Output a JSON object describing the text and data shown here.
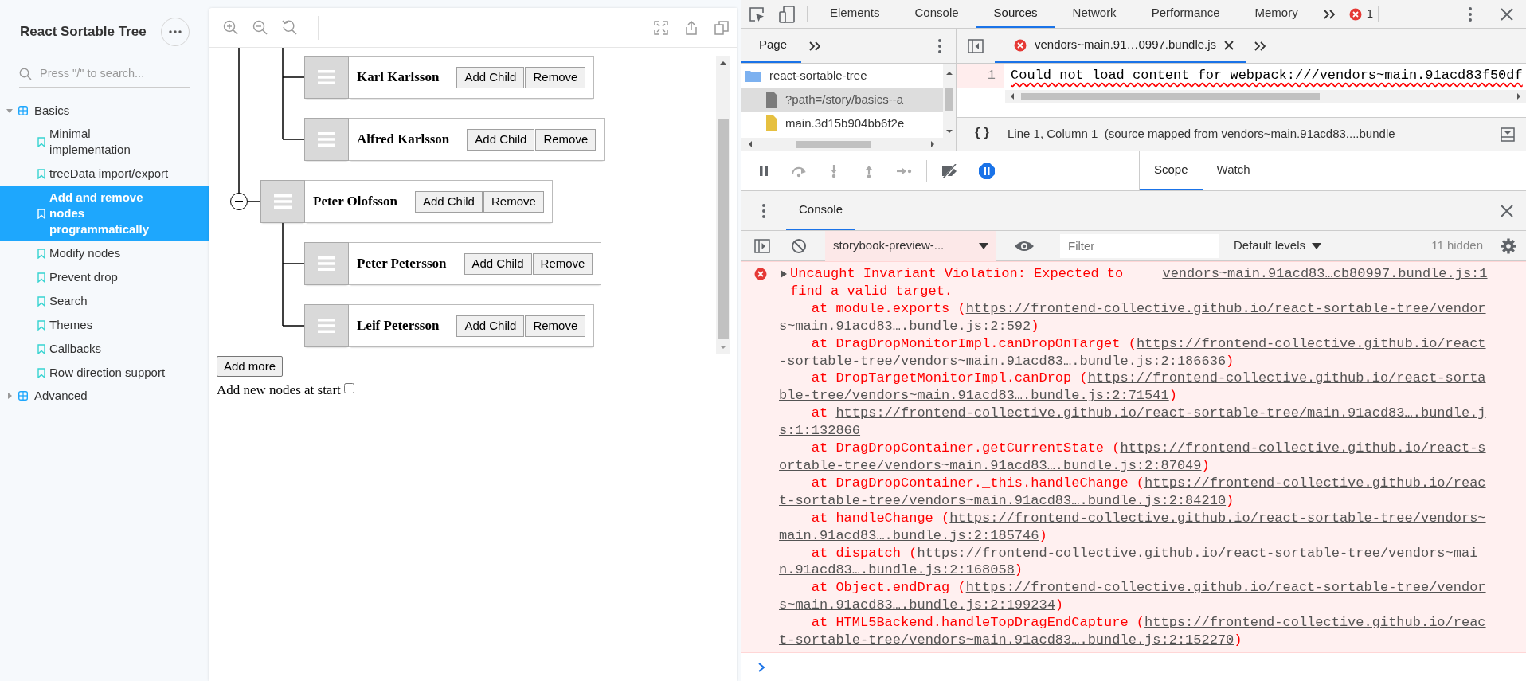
{
  "sidebar": {
    "title": "React Sortable Tree",
    "search": {
      "placeholder": "Press \"/\" to search..."
    },
    "groups": [
      {
        "label": "Basics",
        "expanded": true,
        "children": [
          {
            "label": "Minimal implementation",
            "selected": false
          },
          {
            "label": "treeData import/export",
            "selected": false
          },
          {
            "label": "Add and remove nodes programmatically",
            "selected": true
          },
          {
            "label": "Modify nodes",
            "selected": false
          },
          {
            "label": "Prevent drop",
            "selected": false
          },
          {
            "label": "Search",
            "selected": false
          },
          {
            "label": "Themes",
            "selected": false
          },
          {
            "label": "Callbacks",
            "selected": false
          },
          {
            "label": "Row direction support",
            "selected": false
          }
        ]
      },
      {
        "label": "Advanced",
        "expanded": false
      }
    ]
  },
  "preview": {
    "tree": {
      "nodes": [
        {
          "children": [
            {
              "title": "Karl Karlsson",
              "buttons": [
                "Add Child",
                "Remove"
              ]
            },
            {
              "title": "Alfred Karlsson",
              "buttons": [
                "Add Child",
                "Remove"
              ]
            }
          ]
        },
        {
          "title": "Peter Olofsson",
          "buttons": [
            "Add Child",
            "Remove"
          ],
          "expanded": true,
          "children": [
            {
              "title": "Peter Petersson",
              "buttons": [
                "Add Child",
                "Remove"
              ]
            },
            {
              "title": "Leif Petersson",
              "buttons": [
                "Add Child",
                "Remove"
              ]
            }
          ]
        }
      ]
    },
    "add_button": "Add more",
    "start_option": {
      "label": "Add new nodes at start",
      "checked": false
    }
  },
  "devtools": {
    "tabs": [
      {
        "label": "Elements",
        "selected": false
      },
      {
        "label": "Console",
        "selected": false
      },
      {
        "label": "Sources",
        "selected": true
      },
      {
        "label": "Network",
        "selected": false
      },
      {
        "label": "Performance",
        "selected": false
      },
      {
        "label": "Memory",
        "selected": false
      }
    ],
    "error_count": "1",
    "navigator": {
      "tabs": [
        {
          "label": "Page",
          "selected": true
        }
      ],
      "files": [
        {
          "kind": "folder",
          "name": "react-sortable-tree",
          "selected": false
        },
        {
          "kind": "document",
          "name": "?path=/story/basics--a",
          "selected": true
        },
        {
          "kind": "script",
          "name": "main.3d15b904bb6f2e",
          "selected": false
        }
      ]
    },
    "editor": {
      "tabs": [
        {
          "label": "vendors~main.91…0997.bundle.js",
          "selected": true,
          "error": true
        }
      ],
      "lines": [
        {
          "number": "1",
          "text": "Could not load content for webpack:///vendors~main.91acd83f50df"
        }
      ],
      "status": {
        "format": "{}",
        "position": "Line 1, Column 1",
        "source_prefix": "(source mapped from",
        "source_link": "vendors~main.91acd83....bundle"
      }
    },
    "sidebar_tabs": [
      {
        "label": "Scope",
        "selected": true
      },
      {
        "label": "Watch",
        "selected": false
      }
    ],
    "drawer": {
      "tabs": [
        {
          "label": "Console",
          "selected": true
        }
      ],
      "context": "storybook-preview-...",
      "filter": {
        "placeholder": "Filter"
      },
      "levels": "Default levels",
      "hidden": "11 hidden",
      "messages": [
        {
          "kind": "error",
          "expanded": false,
          "text": "Uncaught Invariant Violation: Expected to find a valid target.",
          "source": "vendors~main.91acd83…cb80997.bundle.js:1",
          "stack": [
            {
              "before": "at module.exports (",
              "url": "https://frontend-collective.github.io/react-sortable-tree/vendors~main.91acd83….bundle.js:2:592",
              "after": ")"
            },
            {
              "before": "at DragDropMonitorImpl.canDropOnTarget (",
              "url": "https://frontend-collective.github.io/react-sortable-tree/vendors~main.91acd83….bundle.js:2:186636",
              "after": ")"
            },
            {
              "before": "at DropTargetMonitorImpl.canDrop (",
              "url": "https://frontend-collective.github.io/react-sortable-tree/vendors~main.91acd83….bundle.js:2:71541",
              "after": ")"
            },
            {
              "before": "at ",
              "url": "https://frontend-collective.github.io/react-sortable-tree/main.91acd83….bundle.js:1:132866"
            },
            {
              "before": "at DragDropContainer.getCurrentState (",
              "url": "https://frontend-collective.github.io/react-sortable-tree/vendors~main.91acd83….bundle.js:2:87049",
              "after": ")"
            },
            {
              "before": "at DragDropContainer._this.handleChange (",
              "url": "https://frontend-collective.github.io/react-sortable-tree/vendors~main.91acd83….bundle.js:2:84210",
              "after": ")"
            },
            {
              "before": "at handleChange (",
              "url": "https://frontend-collective.github.io/react-sortable-tree/vendors~main.91acd83….bundle.js:2:185746",
              "after": ")"
            },
            {
              "before": "at dispatch (",
              "url": "https://frontend-collective.github.io/react-sortable-tree/vendors~main.91acd83….bundle.js:2:168058",
              "after": ")"
            },
            {
              "before": "at Object.endDrag (",
              "url": "https://frontend-collective.github.io/react-sortable-tree/vendors~main.91acd83….bundle.js:2:199234",
              "after": ")"
            },
            {
              "before": "at HTML5Backend.handleTopDragEndCapture (",
              "url": "https://frontend-collective.github.io/react-sortable-tree/vendors~main.91acd83….bundle.js:2:152270",
              "after": ")"
            }
          ]
        }
      ]
    }
  }
}
